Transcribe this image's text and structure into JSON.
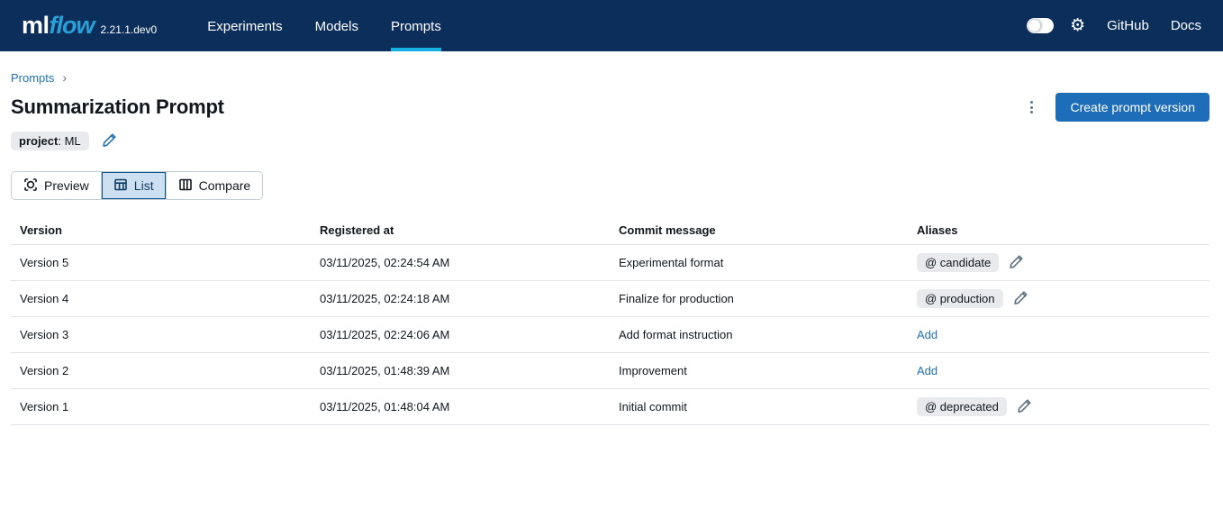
{
  "colors": {
    "navbar_bg": "#0b2e5b",
    "logo_blue": "#2a9fd8",
    "accent_cyan": "#16b1e0",
    "link_blue": "#2272b4",
    "button_bg": "#1d6db8",
    "text_primary": "#11171c",
    "text_secondary": "#5f7281",
    "pill_bg": "#e8eaed",
    "divider": "#dfe3e8",
    "seg_border": "#c5cdd4",
    "selected_tab_bg": "#cde0f1",
    "selected_tab_border": "#0e538b"
  },
  "navbar": {
    "logo_ml": "ml",
    "logo_flow": "flow",
    "version": "2.21.1.dev0",
    "items": [
      {
        "label": "Experiments",
        "active": false
      },
      {
        "label": "Models",
        "active": false
      },
      {
        "label": "Prompts",
        "active": true
      }
    ],
    "right": {
      "github": "GitHub",
      "docs": "Docs"
    }
  },
  "breadcrumb": {
    "link": "Prompts",
    "separator": "›"
  },
  "header": {
    "title": "Summarization Prompt",
    "tag": {
      "key": "project",
      "separator": ": ",
      "value": "ML"
    },
    "create_button": "Create prompt version"
  },
  "view_switcher": {
    "preview": "Preview",
    "list": "List",
    "compare": "Compare",
    "selected": "List"
  },
  "table": {
    "columns": [
      "Version",
      "Registered at",
      "Commit message",
      "Aliases"
    ],
    "rows": [
      {
        "version": "Version 5",
        "registered_at": "03/11/2025, 02:24:54 AM",
        "commit_message": "Experimental format",
        "alias": {
          "type": "tag",
          "label": "@ candidate"
        }
      },
      {
        "version": "Version 4",
        "registered_at": "03/11/2025, 02:24:18 AM",
        "commit_message": "Finalize for production",
        "alias": {
          "type": "tag",
          "label": "@ production"
        }
      },
      {
        "version": "Version 3",
        "registered_at": "03/11/2025, 02:24:06 AM",
        "commit_message": "Add format instruction",
        "alias": {
          "type": "link",
          "label": "Add"
        }
      },
      {
        "version": "Version 2",
        "registered_at": "03/11/2025, 01:48:39 AM",
        "commit_message": "Improvement",
        "alias": {
          "type": "link",
          "label": "Add"
        }
      },
      {
        "version": "Version 1",
        "registered_at": "03/11/2025, 01:48:04 AM",
        "commit_message": "Initial commit",
        "alias": {
          "type": "tag",
          "label": "@ deprecated"
        }
      }
    ]
  }
}
